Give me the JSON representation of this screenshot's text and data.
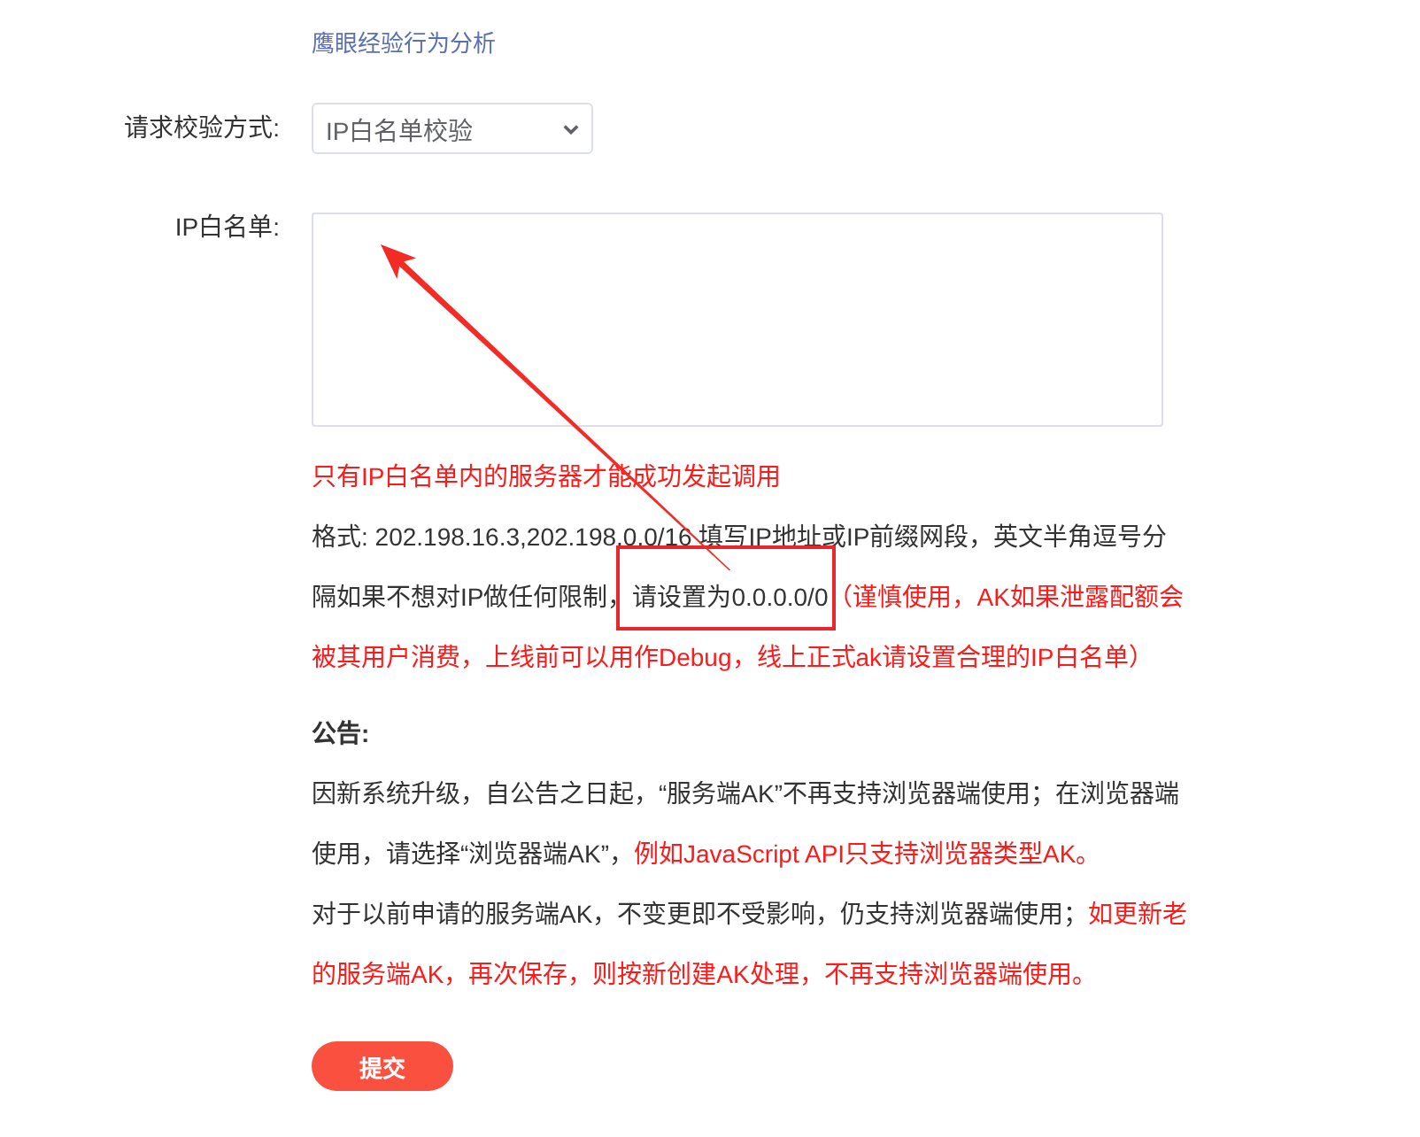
{
  "service_links": [
    {
      "label": "鹰眼经验行为分析"
    }
  ],
  "form": {
    "fields": [
      {
        "kind": "select",
        "label": "请求校验方式:",
        "value": "IP白名单校验",
        "marked_by_arrow": false
      },
      {
        "kind": "textarea",
        "label": "IP白名单:",
        "marked_by_arrow": true
      }
    ],
    "hint_paragraphs": [
      {
        "parts": [
          {
            "warning": true,
            "text": "只有IP白名单内的服务器才能成功发起调用",
            "highlighted": false
          }
        ]
      },
      {
        "parts": [
          {
            "warning": false,
            "text": "格式: 202.198.16.3,202.198.0.0/16 填写IP地址或IP前缀网段，英文半角逗号分隔如果不想对IP做任何限制，",
            "highlighted": false
          },
          {
            "warning": false,
            "text": "请设置为0.0.0.0/0",
            "highlighted": true
          },
          {
            "warning": true,
            "text": "（谨慎使用，AK如果泄露配额会被其用户消费，上线前可以用作Debug，线上正式ak请设置合理的IP白名单）",
            "highlighted": false
          }
        ]
      }
    ],
    "notice": {
      "title": "公告:",
      "paragraphs": [
        {
          "parts": [
            {
              "warning": false,
              "text": "因新系统升级，自公告之日起，“服务端AK”不再支持浏览器端使用；在浏览器端使用，请选择“浏览器端AK”，",
              "highlighted": false
            },
            {
              "warning": true,
              "text": "例如JavaScript API只支持浏览器类型AK。",
              "highlighted": false
            }
          ]
        },
        {
          "parts": [
            {
              "warning": false,
              "text": "对于以前申请的服务端AK，不变更即不受影响，仍支持浏览器端使用；",
              "highlighted": false
            },
            {
              "warning": true,
              "text": "如更新老的服务端AK，再次保存，则按新创建AK处理，不再支持浏览器端使用。",
              "highlighted": false
            }
          ]
        }
      ]
    },
    "submit_button": {
      "label": "提交"
    }
  }
}
